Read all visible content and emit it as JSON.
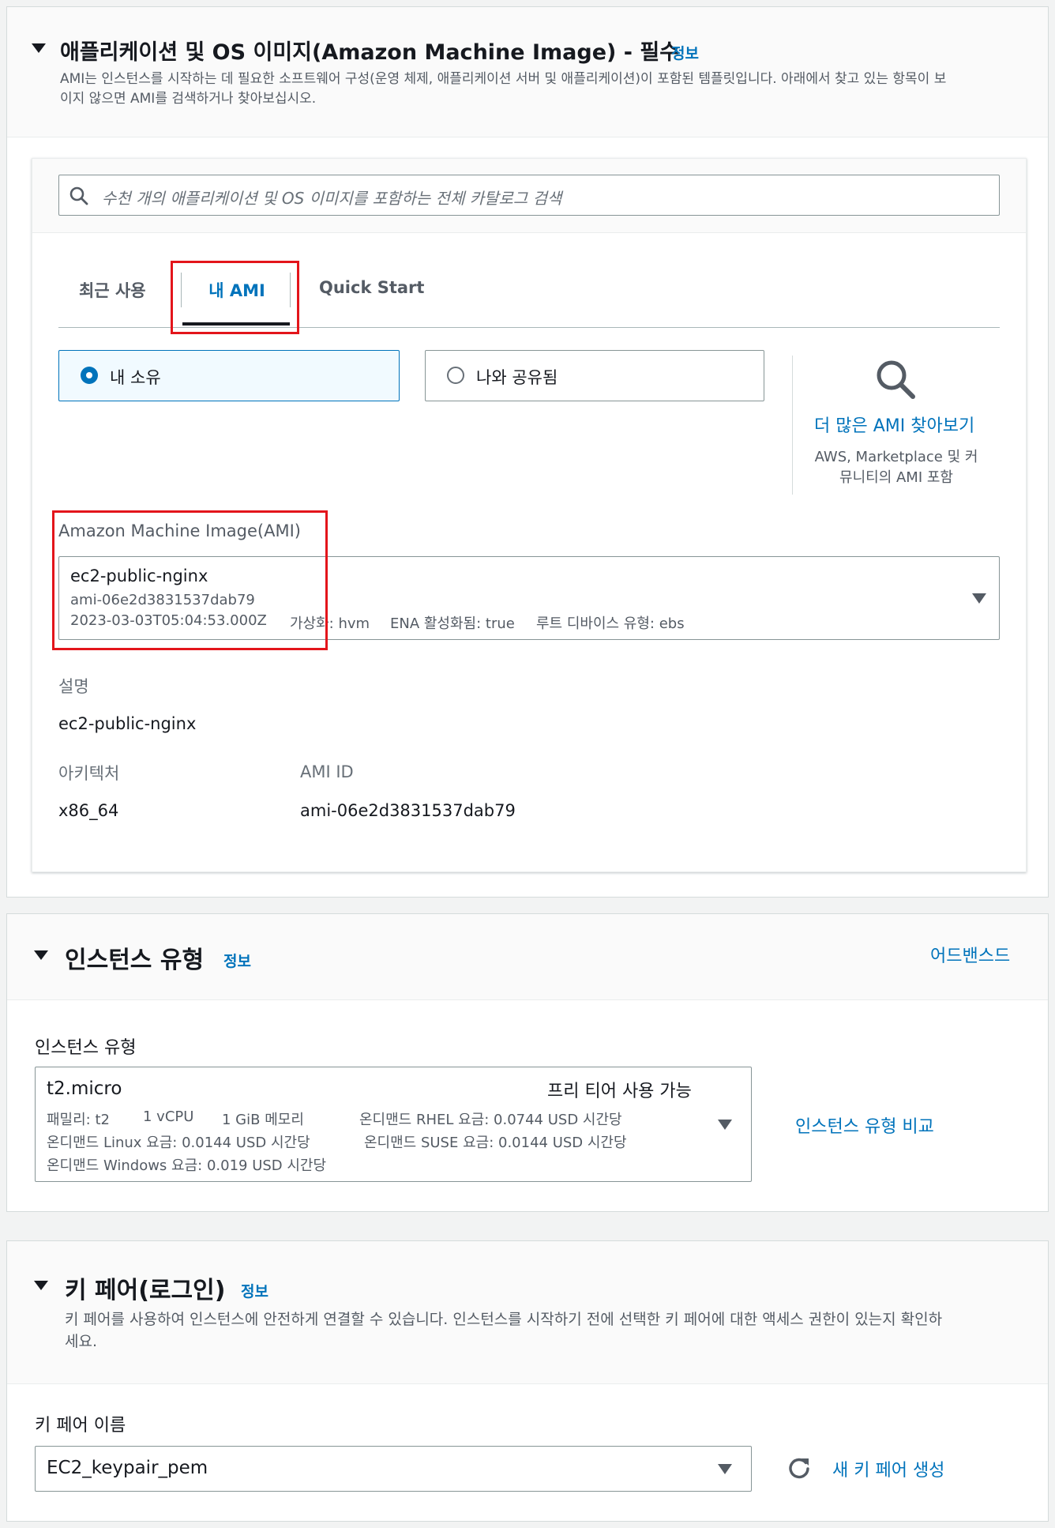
{
  "ami_section": {
    "title": "애플리케이션 및 OS 이미지(Amazon Machine Image) - 필수",
    "info": "정보",
    "description_line1": "AMI는 인스턴스를 시작하는 데 필요한 소프트웨어 구성(운영 체제, 애플리케이션 서버 및 애플리케이션)이 포함된 템플릿입니다. 아래에서 찾고 있는 항목이 보",
    "description_line2": "이지 않으면 AMI를 검색하거나 찾아보십시오.",
    "search_placeholder": "수천 개의 애플리케이션 및 OS 이미지를 포함하는 전체 카탈로그 검색",
    "tabs": [
      {
        "label": "최근 사용",
        "active": false
      },
      {
        "label": "내 AMI",
        "active": true
      },
      {
        "label": "Quick Start",
        "active": false
      }
    ],
    "radio_owned": "내 소유",
    "radio_shared": "나와 공유됨",
    "browse_link": "더 많은 AMI 찾아보기",
    "browse_note_line1": "AWS, Marketplace 및 커",
    "browse_note_line2": "뮤니티의 AMI 포함",
    "ami_label": "Amazon Machine Image(AMI)",
    "ami_select": {
      "name": "ec2-public-nginx",
      "id": "ami-06e2d3831537dab79",
      "date": "2023-03-03T05:04:53.000Z",
      "virtualization": "가상화: hvm",
      "ena": "ENA 활성화됨: true",
      "root_device": "루트 디바이스 유형: ebs"
    },
    "description_label": "설명",
    "description_value": "ec2-public-nginx",
    "arch_label": "아키텍처",
    "arch_value": "x86_64",
    "amiid_label": "AMI ID",
    "amiid_value": "ami-06e2d3831537dab79"
  },
  "instance_section": {
    "title": "인스턴스 유형",
    "info": "정보",
    "advanced_link": "어드밴스드",
    "field_label": "인스턴스 유형",
    "select": {
      "name": "t2.micro",
      "free_tier": "프리 티어 사용 가능",
      "family": "패밀리: t2",
      "vcpu": "1 vCPU",
      "memory": "1 GiB 메모리",
      "rhel": "온디맨드 RHEL 요금: 0.0744 USD 시간당",
      "linux": "온디맨드 Linux 요금: 0.0144 USD 시간당",
      "suse": "온디맨드 SUSE 요금: 0.0144 USD 시간당",
      "windows": "온디맨드 Windows 요금: 0.019 USD 시간당"
    },
    "compare_link": "인스턴스 유형 비교"
  },
  "keypair_section": {
    "title": "키 페어(로그인)",
    "info": "정보",
    "description_line1": "키 페어를 사용하여 인스턴스에 안전하게 연결할 수 있습니다. 인스턴스를 시작하기 전에 선택한 키 페어에 대한 액세스 권한이 있는지 확인하",
    "description_line2": "세요.",
    "field_label": "키 페어 이름",
    "selected": "EC2_keypair_pem",
    "create_link": "새 키 페어 생성"
  },
  "colors": {
    "accent": "#0073bb",
    "highlight": "#e3151b",
    "selected_bg": "#f1faff"
  },
  "icons": [
    "caret-down-icon",
    "search-icon",
    "magnifier-icon",
    "refresh-icon"
  ]
}
